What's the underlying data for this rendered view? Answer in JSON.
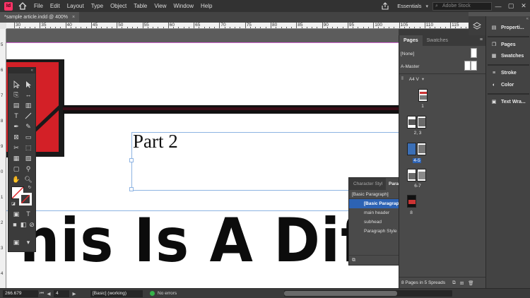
{
  "app": {
    "logo_text": "Id",
    "menu": [
      "File",
      "Edit",
      "Layout",
      "Type",
      "Object",
      "Table",
      "View",
      "Window",
      "Help"
    ],
    "workspace": "Essentials",
    "search_placeholder": "Adobe Stock",
    "window_buttons": [
      "—",
      "▢",
      "✕"
    ]
  },
  "document": {
    "tab_title": "*sample article.indd @ 400%",
    "tab_close": "×"
  },
  "ruler": {
    "h_labels": [
      "30",
      "35",
      "40",
      "45",
      "50",
      "55",
      "60",
      "65",
      "70",
      "75",
      "80",
      "85",
      "90",
      "95",
      "100",
      "105",
      "110",
      "115"
    ],
    "v_labels": [
      "5",
      "6",
      "7",
      "8",
      "9",
      "0",
      "1",
      "2",
      "3",
      "4"
    ]
  },
  "canvas": {
    "subheading": "Part 2",
    "headline": "his Is A Diffe",
    "colors": {
      "red": "#d32027",
      "bleed": "#d36ad3",
      "frame": "#8db3e2"
    }
  },
  "style_panel": {
    "tab1": "Character Styl",
    "tab2": "Para",
    "current": "[Basic Paragraph]",
    "items": [
      "[Basic Paragraph",
      "main header",
      "subhead",
      "Paragraph Style 1"
    ],
    "selected_index": 0
  },
  "pages_panel": {
    "tabs": [
      "Pages",
      "Swatches"
    ],
    "menu_glyph": "≡",
    "none_label": "[None]",
    "master_label": "A-Master",
    "size_label": "A4 V",
    "page_labels": [
      "1",
      "2, 3",
      "4-5",
      "6-7",
      "8"
    ],
    "footer": "8 Pages in 5 Spreads"
  },
  "dock": {
    "items": [
      "Properti...",
      "Pages",
      "Swatches",
      "Stroke",
      "Color",
      "Text Wra..."
    ]
  },
  "status": {
    "zoom": "266.679",
    "page": "4",
    "style": "[Basic] (working)",
    "errors": "No errors"
  }
}
